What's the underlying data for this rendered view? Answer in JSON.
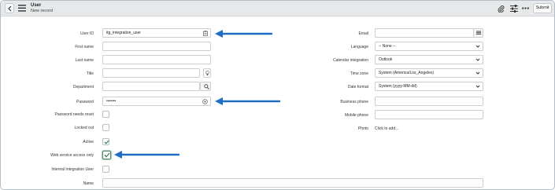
{
  "header": {
    "title": "User",
    "subtitle": "New record",
    "submit_label": "Submit"
  },
  "form": {
    "user_id": {
      "label": "User ID",
      "value": "itg_integration_user"
    },
    "first_name": {
      "label": "First name",
      "value": ""
    },
    "last_name": {
      "label": "Last name",
      "value": ""
    },
    "title": {
      "label": "Title",
      "value": ""
    },
    "department": {
      "label": "Department",
      "value": ""
    },
    "password": {
      "label": "Password",
      "value": "•••••••"
    },
    "password_needs_reset": {
      "label": "Password needs reset",
      "checked": false
    },
    "locked_out": {
      "label": "Locked out",
      "checked": false
    },
    "active": {
      "label": "Active",
      "checked": true
    },
    "web_service_access_only": {
      "label": "Web service access only",
      "checked": true
    },
    "internal_integration_user": {
      "label": "Internal Integration User",
      "checked": false
    },
    "name": {
      "label": "Name",
      "value": ""
    },
    "email": {
      "label": "Email",
      "value": ""
    },
    "language": {
      "label": "Language",
      "value": "-- None --"
    },
    "calendar_integration": {
      "label": "Calendar integration",
      "value": "Outlook"
    },
    "time_zone": {
      "label": "Time zone",
      "value": "System (America/Los_Angeles)"
    },
    "date_format": {
      "label": "Date format",
      "value": "System (yyyy-MM-dd)"
    },
    "business_phone": {
      "label": "Business phone",
      "value": ""
    },
    "mobile_phone": {
      "label": "Mobile phone",
      "value": ""
    },
    "photo": {
      "label": "Photo",
      "link": "Click to add..."
    }
  },
  "colors": {
    "header_bg": "#e6e8ea",
    "arrow": "#1f6fc4",
    "check": "#2e7d4f"
  }
}
